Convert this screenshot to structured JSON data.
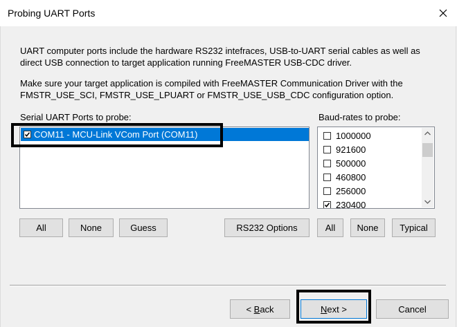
{
  "window": {
    "title": "Probing UART Ports"
  },
  "description": {
    "line1": "UART computer ports include the hardware RS232 intefraces, USB-to-UART serial cables as well as",
    "line2": "direct USB connection to target application running FreeMASTER USB-CDC driver.",
    "line3": "Make sure your target application is compiled with FreeMASTER Communication Driver with the",
    "line4": "FMSTR_USE_SCI, FMSTR_USE_LPUART or FMSTR_USE_USB_CDC configuration option."
  },
  "ports": {
    "label": "Serial UART Ports to probe:",
    "items": [
      {
        "label": "COM11 - MCU-Link VCom Port (COM11)",
        "checked": true,
        "selected": true
      }
    ],
    "buttons": {
      "all": "All",
      "none": "None",
      "guess": "Guess",
      "rs232": "RS232 Options"
    }
  },
  "baud": {
    "label": "Baud-rates to probe:",
    "items": [
      {
        "label": "1000000",
        "checked": false
      },
      {
        "label": "921600",
        "checked": false
      },
      {
        "label": "500000",
        "checked": false
      },
      {
        "label": "460800",
        "checked": false
      },
      {
        "label": "256000",
        "checked": false
      },
      {
        "label": "230400",
        "checked": true
      }
    ],
    "buttons": {
      "all": "All",
      "none": "None",
      "typical": "Typical"
    }
  },
  "footer": {
    "back_prefix": "< ",
    "back_mnemonic": "B",
    "back_rest": "ack",
    "next_mnemonic": "N",
    "next_rest": "ext >",
    "cancel": "Cancel"
  },
  "colors": {
    "selection": "#0078d7",
    "highlight_border": "#000000",
    "dialog_bg": "#f0f0f0"
  }
}
